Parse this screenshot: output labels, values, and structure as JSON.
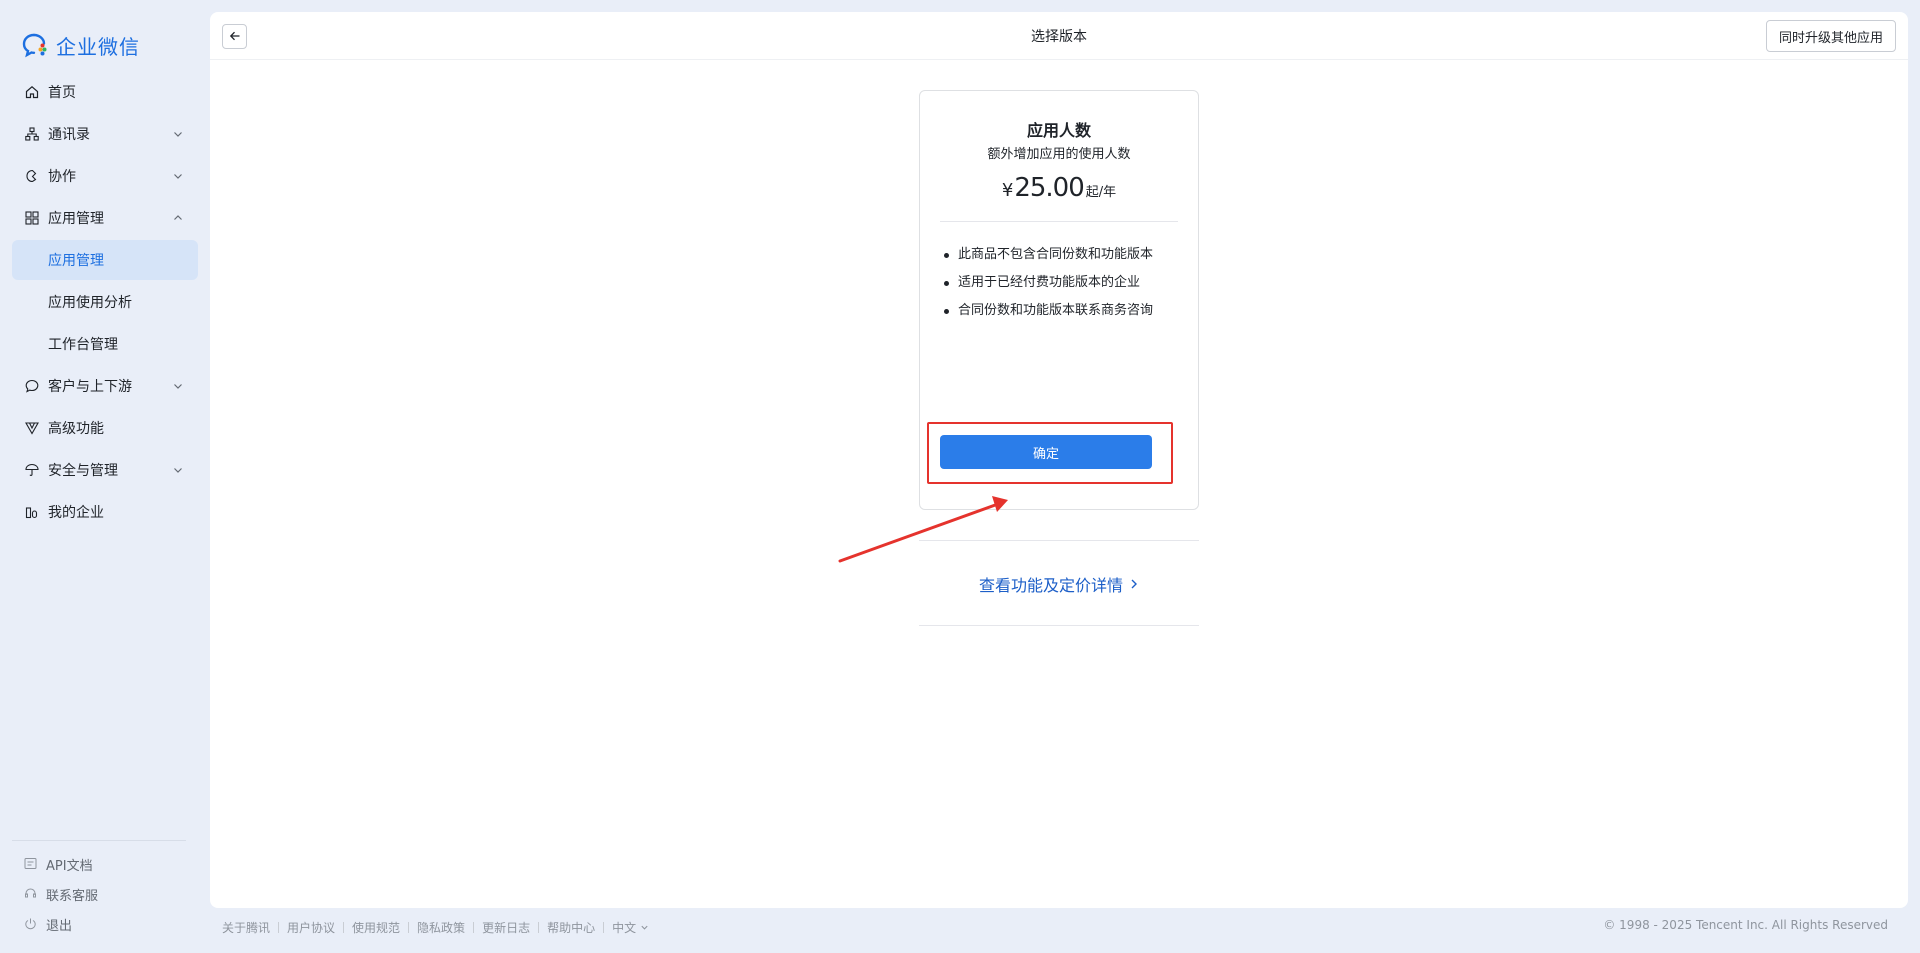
{
  "app": {
    "name": "企业微信",
    "accent_color": "#1d6fe0"
  },
  "sidebar": {
    "items": [
      {
        "label": "首页",
        "icon": "home-icon",
        "expandable": false
      },
      {
        "label": "通讯录",
        "icon": "org-chart-icon",
        "expandable": true
      },
      {
        "label": "协作",
        "icon": "collab-icon",
        "expandable": true
      },
      {
        "label": "应用管理",
        "icon": "grid-icon",
        "expandable": true,
        "expanded": true
      },
      {
        "label": "应用管理",
        "sub": true,
        "active": true
      },
      {
        "label": "应用使用分析",
        "sub": true
      },
      {
        "label": "工作台管理",
        "sub": true
      },
      {
        "label": "客户与上下游",
        "icon": "chat-bubble-icon",
        "expandable": true
      },
      {
        "label": "高级功能",
        "icon": "triangle-icon",
        "expandable": false
      },
      {
        "label": "安全与管理",
        "icon": "umbrella-icon",
        "expandable": true
      },
      {
        "label": "我的企业",
        "icon": "building-icon",
        "expandable": false
      }
    ],
    "bottom": [
      {
        "label": "API文档",
        "icon": "doc-icon"
      },
      {
        "label": "联系客服",
        "icon": "headset-icon"
      },
      {
        "label": "退出",
        "icon": "power-icon"
      }
    ]
  },
  "topbar": {
    "title": "选择版本",
    "upgrade_label": "同时升级其他应用"
  },
  "card": {
    "title": "应用人数",
    "subtitle": "额外增加应用的使用人数",
    "price_currency": "¥",
    "price_amount": "25.00",
    "price_unit": "起/年",
    "features": [
      "此商品不包含合同份数和功能版本",
      "适用于已经付费功能版本的企业",
      "合同份数和功能版本联系商务咨询"
    ],
    "confirm_label": "确定"
  },
  "details_link": "查看功能及定价详情",
  "footer": {
    "links": [
      "关于腾讯",
      "用户协议",
      "使用规范",
      "隐私政策",
      "更新日志",
      "帮助中心"
    ],
    "language": "中文",
    "copyright": "© 1998 - 2025 Tencent Inc. All Rights Reserved"
  },
  "annotation_color": "#e5332d"
}
